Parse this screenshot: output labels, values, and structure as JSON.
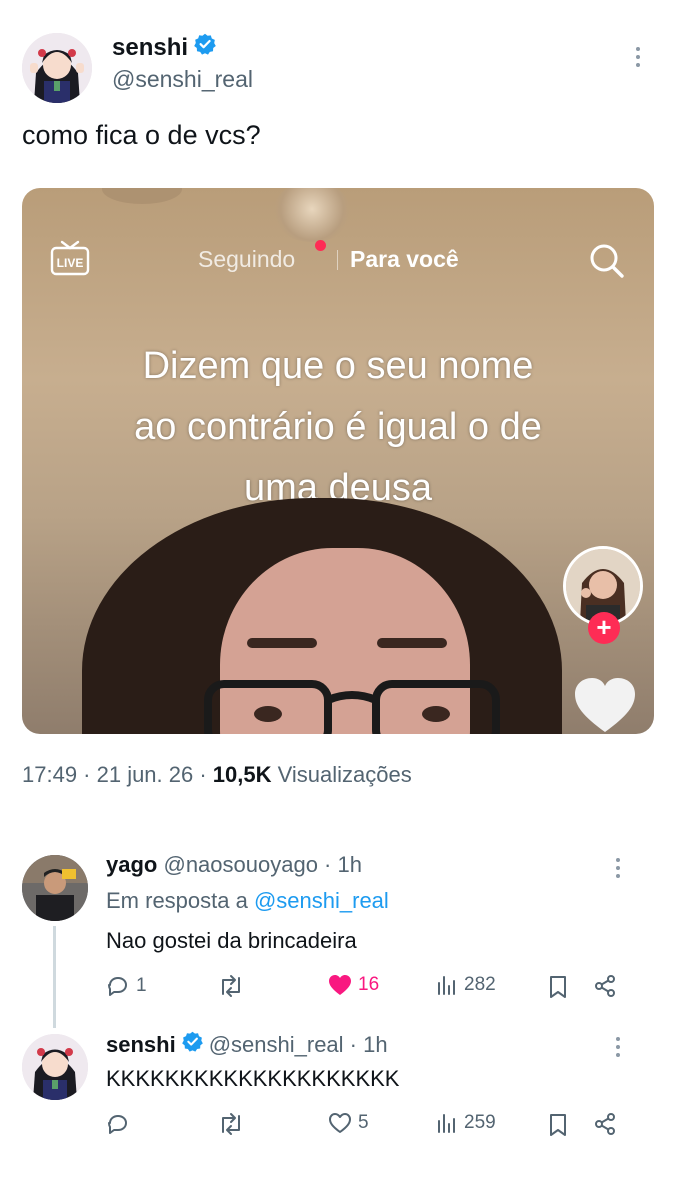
{
  "tweet": {
    "display_name": "senshi",
    "handle": "@senshi_real",
    "text": "como fica o de vcs?",
    "meta_time": "17:49 · 21 jun. 26 · ",
    "meta_views_count": "10,5K",
    "meta_views_label": " Visualizações"
  },
  "video": {
    "live_label": "LIVE",
    "tab_following": "Seguindo",
    "tab_foryou": "Para você",
    "caption_line1": "Dizem que o seu nome",
    "caption_line2": "ao contrário é igual o de",
    "caption_line3": "uma deusa",
    "follow_symbol": "+"
  },
  "replies": [
    {
      "display_name": "yago",
      "handle": "@naosouoyago",
      "time": " · 1h",
      "reply_to_prefix": "Em resposta a ",
      "reply_to_handle": "@senshi_real",
      "text": "Nao gostei da brincadeira",
      "reply_count": "1",
      "like_count": "16",
      "like_color": "#f91880",
      "views": "282"
    },
    {
      "display_name": "senshi",
      "handle": "@senshi_real",
      "time": " · 1h",
      "text": "KKKKKKKKKKKKKKKKKKKK",
      "reply_count": "",
      "like_count": "5",
      "views": "259"
    }
  ],
  "colors": {
    "accent": "#1d9bf0",
    "muted": "#536471",
    "like": "#f91880"
  }
}
